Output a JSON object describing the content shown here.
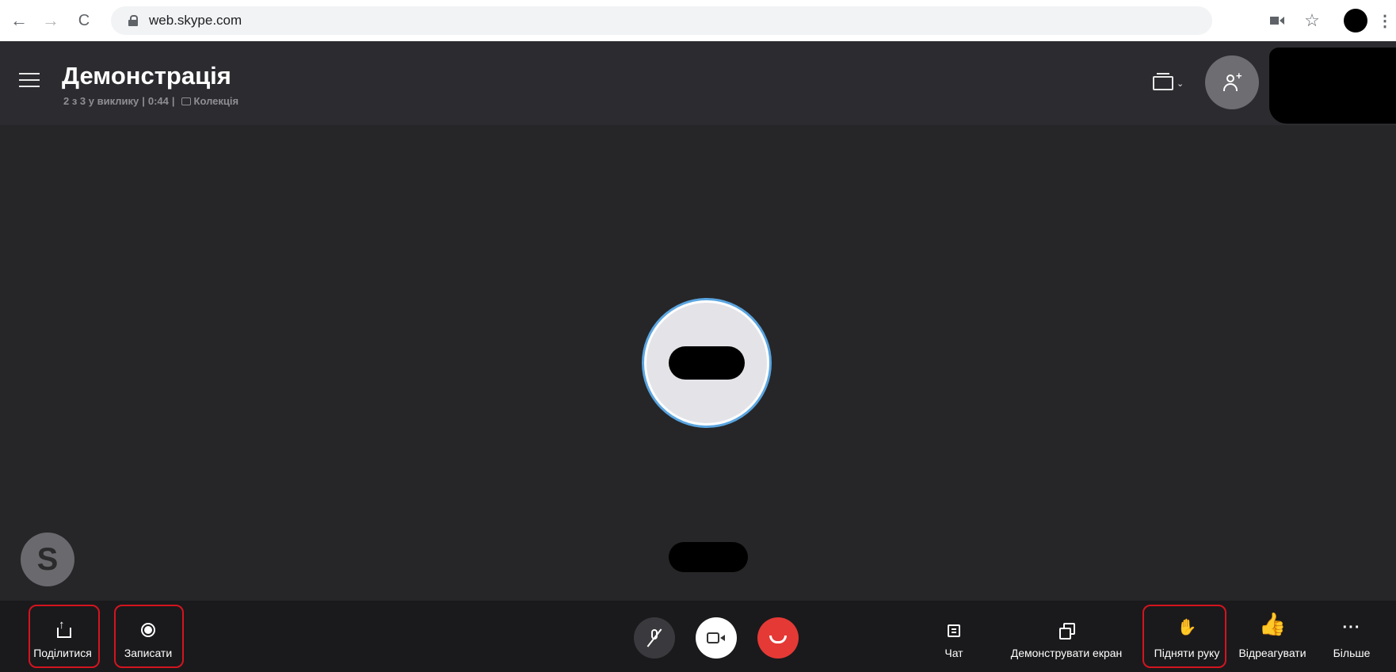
{
  "browser": {
    "url": "web.skype.com",
    "icons": {
      "back": "arrow-left-icon",
      "forward": "arrow-right-icon",
      "reload": "reload-icon",
      "lock": "lock-icon",
      "camera_indicator": "camera-in-use-icon",
      "bookmark": "star-icon",
      "menu": "kebab-menu-icon"
    },
    "glyphs": {
      "back": "←",
      "forward": "→",
      "reload": "C",
      "star": "☆",
      "kebab": "⋮"
    }
  },
  "call": {
    "title": "Демонстрація",
    "subtitle_participants": "2 з 3 у виклику",
    "subtitle_duration": "0:44",
    "subtitle_separator": "|",
    "subtitle_collection": "Колекція",
    "layout_chevron": "⌄",
    "skype_logo_letter": "S"
  },
  "toolbar": {
    "share_label": "Поділитися",
    "record_label": "Записати",
    "chat_label": "Чат",
    "screen_share_label": "Демонструвати екран",
    "raise_hand_label": "Підняти руку",
    "react_label": "Відреагувати",
    "more_label": "Більше",
    "raise_hand_glyph": "✋",
    "react_glyph": "👍",
    "more_glyph": "···"
  },
  "colors": {
    "stage_bg": "#262628",
    "header_bg": "#2c2c30",
    "bottombar_bg": "#1a1a1c",
    "end_call": "#e53935",
    "highlight_outline": "#d4141f",
    "avatar_ring": "#5aa5e0",
    "like_yellow": "#f4b63f"
  }
}
